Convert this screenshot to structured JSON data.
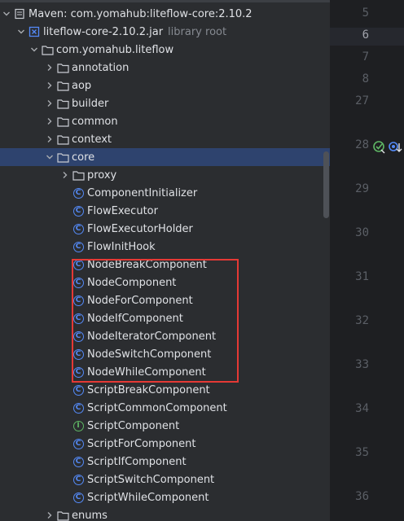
{
  "project_tree": {
    "maven_library": "Maven: com.yomahub:liteflow-core:2.10.2",
    "jar": {
      "name": "liteflow-core-2.10.2.jar",
      "hint": "library root"
    },
    "package": "com.yomahub.liteflow",
    "folders_before": [
      "annotation",
      "aop",
      "builder",
      "common",
      "context"
    ],
    "selected_folder": "core",
    "subfolder": "proxy",
    "classes": [
      "ComponentInitializer",
      "FlowExecutor",
      "FlowExecutorHolder",
      "FlowInitHook",
      "NodeBreakComponent",
      "NodeComponent",
      "NodeForComponent",
      "NodeIfComponent",
      "NodeIteratorComponent",
      "NodeSwitchComponent",
      "NodeWhileComponent",
      "ScriptBreakComponent",
      "ScriptCommonComponent",
      "ScriptComponent",
      "ScriptForComponent",
      "ScriptIfComponent",
      "ScriptSwitchComponent",
      "ScriptWhileComponent"
    ],
    "interface_class": "ScriptComponent",
    "folder_after": "enums"
  },
  "editor_gutter": {
    "line_numbers": [
      "5",
      "6",
      "7",
      "8",
      "27",
      "28",
      "29",
      "30",
      "31",
      "32",
      "33",
      "34",
      "35",
      "36"
    ],
    "current_line": "6"
  },
  "colors": {
    "selection": "#2e436e",
    "highlight_box": "#e53935",
    "class_icon": "#548af7",
    "interface_icon": "#5fb865"
  }
}
